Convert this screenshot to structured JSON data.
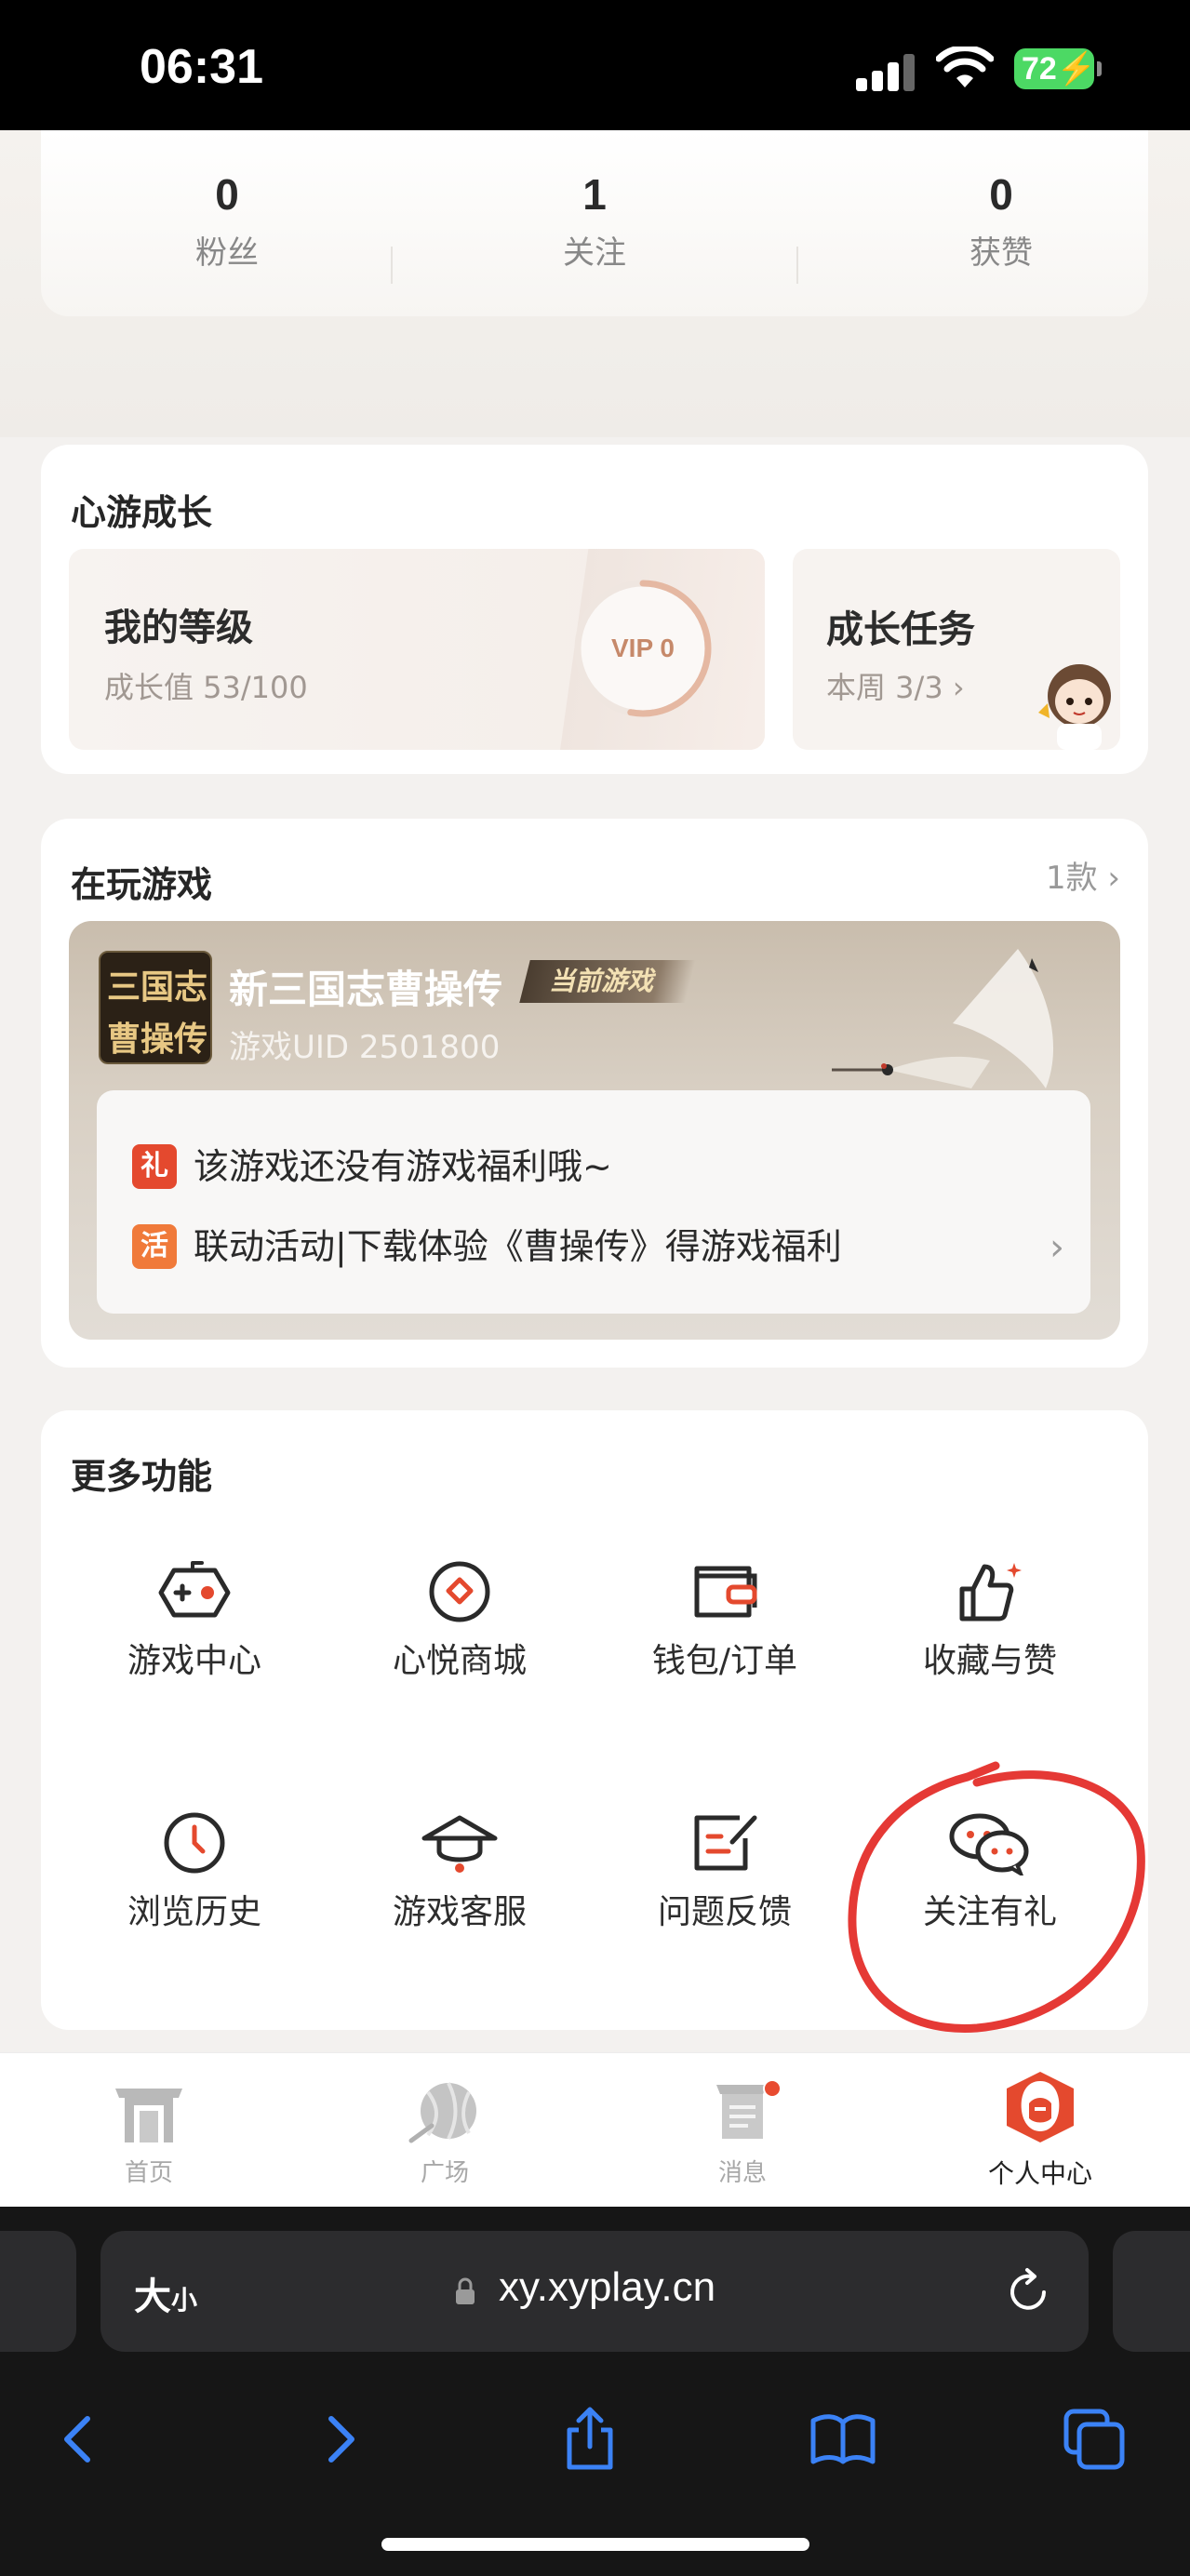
{
  "status_bar": {
    "time": "06:31",
    "battery": "72"
  },
  "stats": [
    {
      "value": "0",
      "label": "粉丝"
    },
    {
      "value": "1",
      "label": "关注"
    },
    {
      "value": "0",
      "label": "获赞"
    }
  ],
  "growth": {
    "title": "心游成长",
    "level_title": "我的等级",
    "level_sub": "成长值 53/100",
    "vip": "VIP 0",
    "progress": 0.53,
    "task_title": "成长任务",
    "task_sub": "本周 3/3"
  },
  "playing": {
    "title": "在玩游戏",
    "count": "1款",
    "game_icon_lines": [
      "三国志",
      "曹操传"
    ],
    "game_name": "新三国志曹操传",
    "game_tag": "当前游戏",
    "game_uid": "游戏UID 2501800",
    "benefits": [
      {
        "badge": "礼",
        "text": "该游戏还没有游戏福利哦~",
        "color": "#e4492e"
      },
      {
        "badge": "活",
        "text": "联动活动|下载体验《曹操传》得游戏福利",
        "color": "#f07a3a"
      }
    ]
  },
  "more": {
    "title": "更多功能",
    "items": [
      {
        "label": "游戏中心",
        "icon": "gamepad-icon"
      },
      {
        "label": "心悦商城",
        "icon": "mall-icon"
      },
      {
        "label": "钱包/订单",
        "icon": "wallet-icon"
      },
      {
        "label": "收藏与赞",
        "icon": "thumbs-up-icon"
      },
      {
        "label": "浏览历史",
        "icon": "clock-icon"
      },
      {
        "label": "游戏客服",
        "icon": "support-hat-icon"
      },
      {
        "label": "问题反馈",
        "icon": "feedback-icon"
      },
      {
        "label": "关注有礼",
        "icon": "wechat-icon"
      }
    ]
  },
  "tabs": [
    {
      "label": "首页",
      "icon": "home-gate-icon"
    },
    {
      "label": "广场",
      "icon": "plaza-icon"
    },
    {
      "label": "消息",
      "icon": "message-icon"
    },
    {
      "label": "个人中心",
      "icon": "profile-icon"
    }
  ],
  "browser": {
    "text_size": "大",
    "text_size_small": "小",
    "url": "xy.xyplay.cn"
  },
  "colors": {
    "accent": "#e4492e",
    "ios_blue": "#3b82f6",
    "vip": "#c6896a"
  }
}
